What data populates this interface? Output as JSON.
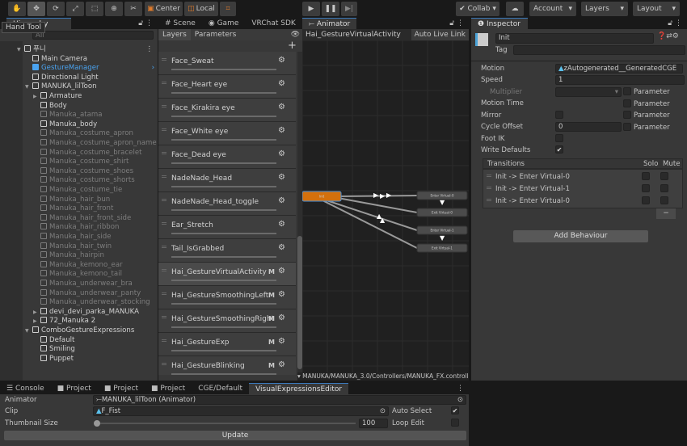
{
  "toolbar": {
    "tools": [
      "hand",
      "move",
      "rotate",
      "scale",
      "rect",
      "transform",
      "custom"
    ],
    "center": "Center",
    "local": "Local",
    "collab": "Collab",
    "account": "Account",
    "layers": "Layers",
    "layout": "Layout"
  },
  "tooltip": "Hand Tool",
  "hierarchy": {
    "tab": "Hierarchy",
    "search_placeholder": "All",
    "items": [
      {
        "label": "푸니",
        "depth": 0,
        "arrow": "open",
        "scene": true
      },
      {
        "label": "Main Camera",
        "depth": 1
      },
      {
        "label": "GestureManager",
        "depth": 1,
        "highlight": true,
        "child_arrow": true
      },
      {
        "label": "Directional Light",
        "depth": 1
      },
      {
        "label": "MANUKA_lilToon",
        "depth": 1,
        "arrow": "open"
      },
      {
        "label": "Armature",
        "depth": 2,
        "arrow": "closed"
      },
      {
        "label": "Body",
        "depth": 2
      },
      {
        "label": "Manuka_atama",
        "depth": 2,
        "dim": true
      },
      {
        "label": "Manuka_body",
        "depth": 2
      },
      {
        "label": "Manuka_costume_apron",
        "depth": 2,
        "dim": true
      },
      {
        "label": "Manuka_costume_apron_name",
        "depth": 2,
        "dim": true
      },
      {
        "label": "Manuka_costume_bracelet",
        "depth": 2,
        "dim": true
      },
      {
        "label": "Manuka_costume_shirt",
        "depth": 2,
        "dim": true
      },
      {
        "label": "Manuka_costume_shoes",
        "depth": 2,
        "dim": true
      },
      {
        "label": "Manuka_costume_shorts",
        "depth": 2,
        "dim": true
      },
      {
        "label": "Manuka_costume_tie",
        "depth": 2,
        "dim": true
      },
      {
        "label": "Manuka_hair_bun",
        "depth": 2,
        "dim": true
      },
      {
        "label": "Manuka_hair_front",
        "depth": 2,
        "dim": true
      },
      {
        "label": "Manuka_hair_front_side",
        "depth": 2,
        "dim": true
      },
      {
        "label": "Manuka_hair_ribbon",
        "depth": 2,
        "dim": true
      },
      {
        "label": "Manuka_hair_side",
        "depth": 2,
        "dim": true
      },
      {
        "label": "Manuka_hair_twin",
        "depth": 2,
        "dim": true
      },
      {
        "label": "Manuka_hairpin",
        "depth": 2,
        "dim": true
      },
      {
        "label": "Manuka_kemono_ear",
        "depth": 2,
        "dim": true
      },
      {
        "label": "Manuka_kemono_tail",
        "depth": 2,
        "dim": true
      },
      {
        "label": "Manuka_underwear_bra",
        "depth": 2,
        "dim": true
      },
      {
        "label": "Manuka_underwear_panty",
        "depth": 2,
        "dim": true
      },
      {
        "label": "Manuka_underwear_stocking",
        "depth": 2,
        "dim": true
      },
      {
        "label": "devi_devi_parka_MANUKA",
        "depth": 2,
        "arrow": "closed"
      },
      {
        "label": "72_Manuka 2",
        "depth": 2,
        "arrow": "closed"
      },
      {
        "label": "ComboGestureExpressions",
        "depth": 1,
        "arrow": "open"
      },
      {
        "label": "Default",
        "depth": 2
      },
      {
        "label": "Smiling",
        "depth": 2
      },
      {
        "label": "Puppet",
        "depth": 2
      }
    ]
  },
  "center_tabs": [
    "Scene",
    "Game",
    "VRChat SDK",
    "Animator"
  ],
  "animator": {
    "subtabs": [
      "Layers",
      "Parameters"
    ],
    "breadcrumb": "Hai_GestureVirtualActivity",
    "auto_live_link": "Auto Live Link",
    "path": "MANUKA/MANUKA_3.0/Controllers/MANUKA_FX.controller",
    "layers": [
      {
        "name": "Face_Sweat"
      },
      {
        "name": "Face_Heart eye"
      },
      {
        "name": "Face_Kirakira eye"
      },
      {
        "name": "Face_White eye"
      },
      {
        "name": "Face_Dead eye"
      },
      {
        "name": "NadeNade_Head"
      },
      {
        "name": "NadeNade_Head_toggle"
      },
      {
        "name": "Ear_Stretch"
      },
      {
        "name": "Tail_IsGrabbed"
      },
      {
        "name": "Hai_GestureVirtualActivity",
        "m": "M",
        "selected": true
      },
      {
        "name": "Hai_GestureSmoothingLeft",
        "m": "M"
      },
      {
        "name": "Hai_GestureSmoothingRight",
        "m": "M"
      },
      {
        "name": "Hai_GestureExp",
        "m": "M"
      },
      {
        "name": "Hai_GestureBlinking",
        "m": "M"
      }
    ],
    "states": [
      {
        "name": "Init",
        "color": "#d4700c"
      },
      {
        "name": "Enter Virtual-0"
      },
      {
        "name": "Exit Virtual-0"
      },
      {
        "name": "Enter Virtual-1"
      },
      {
        "name": "Exit Virtual-1"
      }
    ]
  },
  "inspector": {
    "tab": "Inspector",
    "name": "Init",
    "tag_label": "Tag",
    "motion_label": "Motion",
    "motion": "zAutogenerated__GeneratedCGE",
    "speed_label": "Speed",
    "speed": "1",
    "multiplier_label": "Multiplier",
    "motion_time_label": "Motion Time",
    "mirror_label": "Mirror",
    "cycle_offset_label": "Cycle Offset",
    "cycle_offset": "0",
    "foot_ik_label": "Foot IK",
    "write_defaults_label": "Write Defaults",
    "write_defaults": true,
    "parameter_label": "Parameter",
    "transitions_label": "Transitions",
    "solo_label": "Solo",
    "mute_label": "Mute",
    "transitions": [
      "Init -> Enter Virtual-0",
      "Init -> Enter Virtual-1",
      "Init -> Enter Virtual-0"
    ],
    "remove": "−",
    "add_behaviour": "Add Behaviour"
  },
  "bottom": {
    "tabs": [
      "Console",
      "Project",
      "Project",
      "Project",
      "CGE/Default",
      "VisualExpressionsEditor"
    ],
    "animator_label": "Animator",
    "animator": "MANUKA_lilToon (Animator)",
    "clip_label": "Clip",
    "clip": "F_Fist",
    "auto_select_label": "Auto Select",
    "auto_select": true,
    "thumb_label": "Thumbnail Size",
    "thumb_value": "100",
    "thumb_fraction": 0.0,
    "loop_edit_label": "Loop Edit",
    "loop_edit": false,
    "update": "Update"
  },
  "colors": {
    "accent": "#3a79bb",
    "highlight_text": "#4aa3f0",
    "state_orange": "#d4700c"
  }
}
